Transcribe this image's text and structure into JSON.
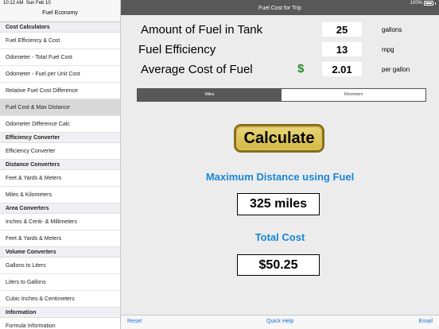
{
  "status": {
    "time": "10:12 AM",
    "date": "Sun Feb 10",
    "battery": "100%"
  },
  "sidebar": {
    "title": "Fuel Economy",
    "items": [
      {
        "type": "section",
        "label": "Cost Calculators"
      },
      {
        "type": "item",
        "label": "Fuel Efficiency & Cost"
      },
      {
        "type": "item",
        "label": "Odometer - Total Fuel Cost"
      },
      {
        "type": "item",
        "label": "Odometer - Fuel per Unit Cost"
      },
      {
        "type": "item",
        "label": "Relative Fuel Cost Difference"
      },
      {
        "type": "item",
        "label": "Fuel Cost & Max Distance",
        "selected": true
      },
      {
        "type": "item",
        "label": "Odometer Difference Calc"
      },
      {
        "type": "section",
        "label": "Efficiency Converter"
      },
      {
        "type": "item",
        "label": "Efficiency Converter"
      },
      {
        "type": "section",
        "label": "Distance Converters"
      },
      {
        "type": "item",
        "label": "Feet & Yards & Meters"
      },
      {
        "type": "item",
        "label": "Miles & Kilometers"
      },
      {
        "type": "section",
        "label": "Area Converters"
      },
      {
        "type": "item",
        "label": "Inches & Centi- & Millimeters"
      },
      {
        "type": "item",
        "label": "Feet & Yards & Meters"
      },
      {
        "type": "section",
        "label": "Volume Converters"
      },
      {
        "type": "item",
        "label": "Gallons to Liters"
      },
      {
        "type": "item",
        "label": "Liters to Gallons"
      },
      {
        "type": "item",
        "label": "Cubic Inches & Centimeters"
      },
      {
        "type": "section",
        "label": "Information"
      },
      {
        "type": "item",
        "label": "Formula Information"
      }
    ]
  },
  "main": {
    "title": "Fuel Cost for Trip",
    "fields": {
      "fuel_amount": {
        "label": "Amount of Fuel in Tank",
        "value": "25",
        "unit": "gallons"
      },
      "efficiency": {
        "label": "Fuel Efficiency",
        "value": "13",
        "unit": "mpg"
      },
      "avg_cost": {
        "label": "Average Cost of Fuel",
        "currency": "$",
        "value": "2.01",
        "unit": "per gallon"
      }
    },
    "segment": {
      "miles": "Miles",
      "kilometers": "Kilometers",
      "selected": "Miles"
    },
    "calculate_label": "Calculate",
    "max_distance_heading": "Maximum Distance using Fuel",
    "max_distance_value": "325 miles",
    "total_cost_heading": "Total Cost",
    "total_cost_value": "$50.25"
  },
  "toolbar": {
    "reset": "Reset",
    "quick_help": "Quick Help",
    "email": "Email"
  },
  "colors": {
    "nav_bar": "#585858",
    "accent_blue": "#1a86d8",
    "dollar_green": "#2a8a2a",
    "button_gold": "#d4b840"
  }
}
